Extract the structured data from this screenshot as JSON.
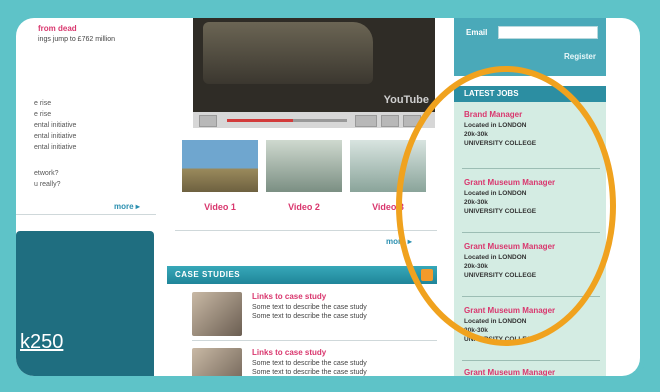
{
  "news": {
    "headline": "from dead",
    "subline": "ings jump to £762 million",
    "items": [
      "e rise",
      "e rise",
      "ental initiative",
      "ental initiative",
      "ental initiative"
    ],
    "items2": [
      "etwork?",
      "u really?"
    ],
    "more": "more ▸"
  },
  "promo": {
    "text": "k250"
  },
  "video": {
    "logo": "YouTube",
    "thumbnails": [
      {
        "label": "Video 1"
      },
      {
        "label": "Video 2"
      },
      {
        "label": "Video 3"
      }
    ],
    "more": "more ▸"
  },
  "case_studies": {
    "header": "CASE STUDIES",
    "items": [
      {
        "title": "Links to case study",
        "desc1": "Some text to describe the case study",
        "desc2": "Some text to describe the case study"
      },
      {
        "title": "Links to case study",
        "desc1": "Some text to describe the case study",
        "desc2": "Some text to describe the case study"
      }
    ]
  },
  "register": {
    "email_label": "Email",
    "email_value": "",
    "button": "Register"
  },
  "jobs": {
    "header": "LATEST JOBS",
    "items": [
      {
        "title": "Brand Manager",
        "location": "Located in LONDON",
        "salary": "20k-30k",
        "employer": "UNIVERSITY COLLEGE"
      },
      {
        "title": "Grant Museum Manager",
        "location": "Located in LONDON",
        "salary": "20k-30k",
        "employer": "UNIVERSITY COLLEGE"
      },
      {
        "title": "Grant Museum Manager",
        "location": "Located in LONDON",
        "salary": "20k-30k",
        "employer": "UNIVERSITY COLLEGE"
      },
      {
        "title": "Grant Museum Manager",
        "location": "Located in LONDON",
        "salary": "20k-30k",
        "employer": "UNIVERSITY COLLEGE"
      },
      {
        "title": "Grant Museum Manager"
      }
    ]
  },
  "colors": {
    "accent_pink": "#d9376e",
    "teal": "#2c8ea2",
    "ring": "#f0a21e",
    "frame": "#5ec3c8"
  }
}
